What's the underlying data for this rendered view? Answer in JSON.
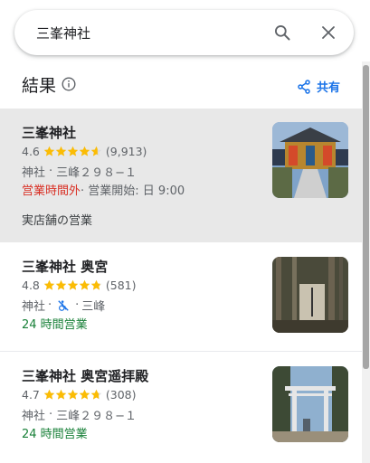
{
  "search": {
    "value": "三峯神社"
  },
  "header": {
    "title": "結果",
    "share_label": "共有"
  },
  "colors": {
    "accent": "#1a73e8",
    "star": "#fbbc04",
    "closed": "#d93025",
    "open": "#188038",
    "selected_bg": "#e8e8e8"
  },
  "results": [
    {
      "name": "三峯神社",
      "rating": "4.6",
      "stars": 4.6,
      "reviews": "(9,913)",
      "category": "神社",
      "sep": "·",
      "address": "三峰２９８−１",
      "status": "営業時間外",
      "status_sep": " · 営業開始: 日 9:00",
      "extra": "実店舗の営業"
    },
    {
      "name": "三峯神社 奥宮",
      "rating": "4.8",
      "stars": 4.8,
      "reviews": "(581)",
      "category": "神社",
      "sep": "·",
      "sep2": "·",
      "address": "三峰",
      "status": "24 時間営業",
      "icon": "no-wheelchair-icon"
    },
    {
      "name": "三峯神社 奥宮遥拝殿",
      "rating": "4.7",
      "stars": 4.7,
      "reviews": "(308)",
      "category": "神社",
      "sep": "·",
      "address": "三峰２９８−１",
      "status": "24 時間営業"
    }
  ]
}
